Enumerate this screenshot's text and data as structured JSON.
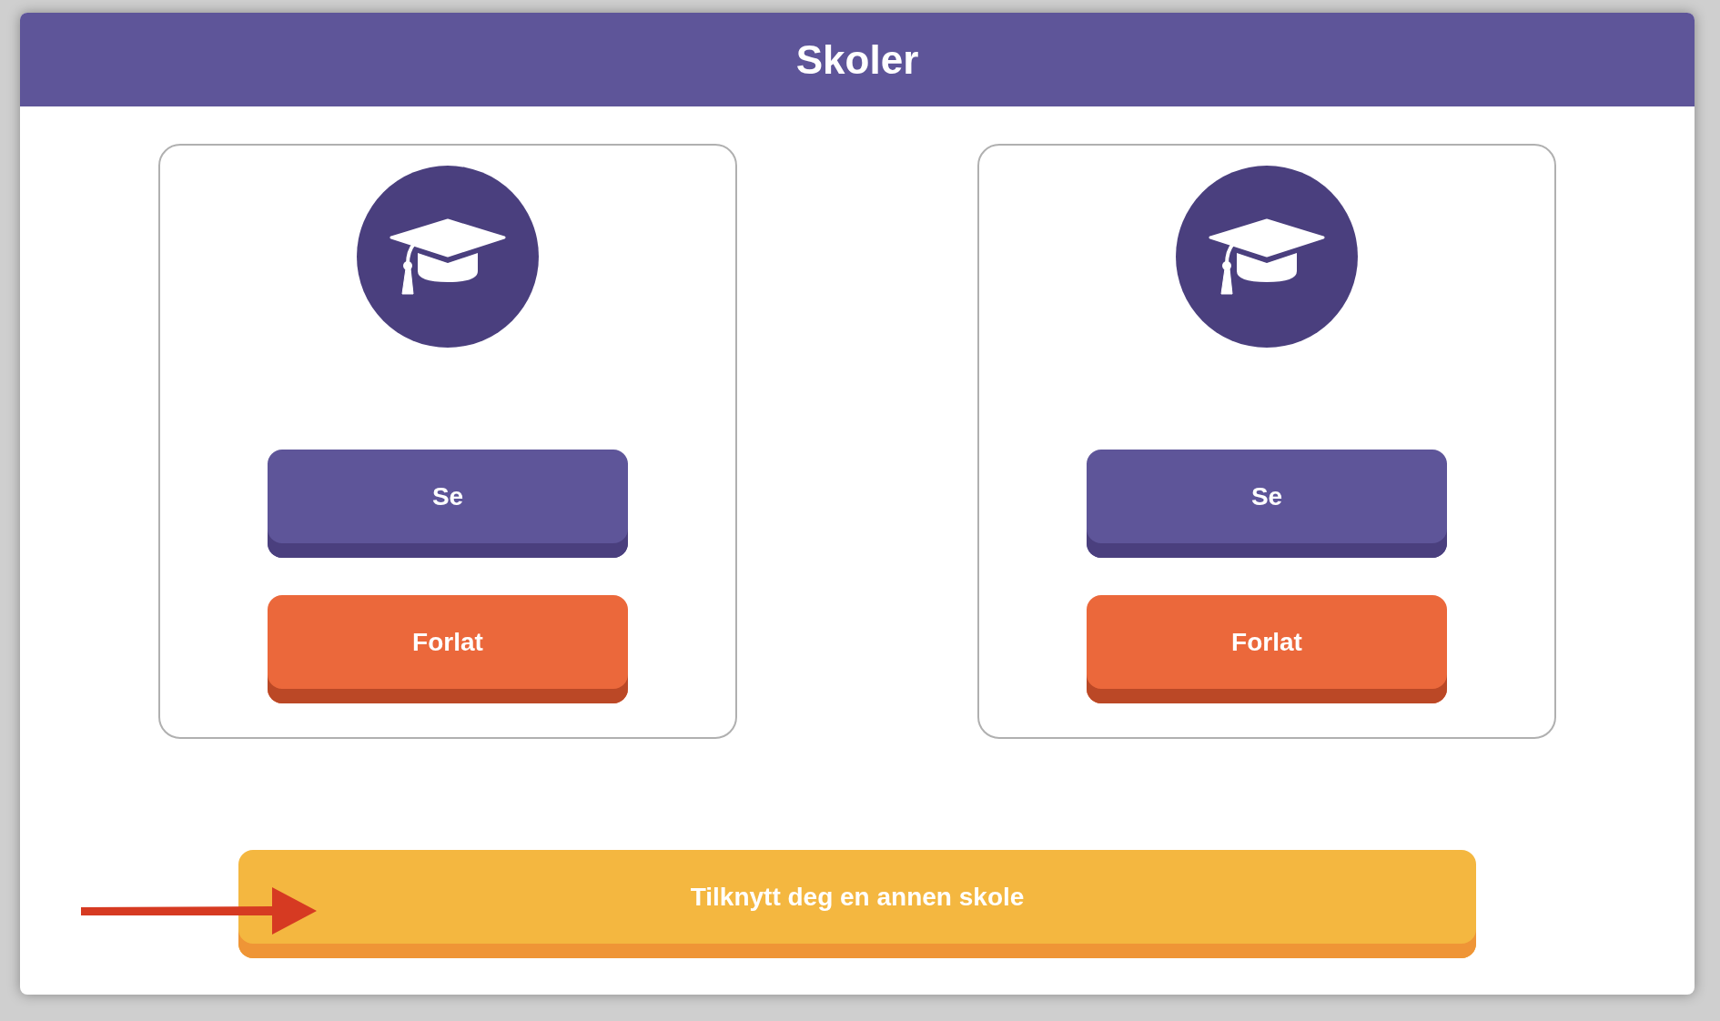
{
  "header": {
    "title": "Skoler"
  },
  "schools": [
    {
      "buttons": [
        {
          "kind": "view",
          "label": "Se"
        },
        {
          "kind": "leave",
          "label": "Forlat"
        }
      ]
    },
    {
      "buttons": [
        {
          "kind": "view",
          "label": "Se"
        },
        {
          "kind": "leave",
          "label": "Forlat"
        }
      ]
    }
  ],
  "join_button": {
    "label": "Tilknytt deg en annen skole"
  }
}
